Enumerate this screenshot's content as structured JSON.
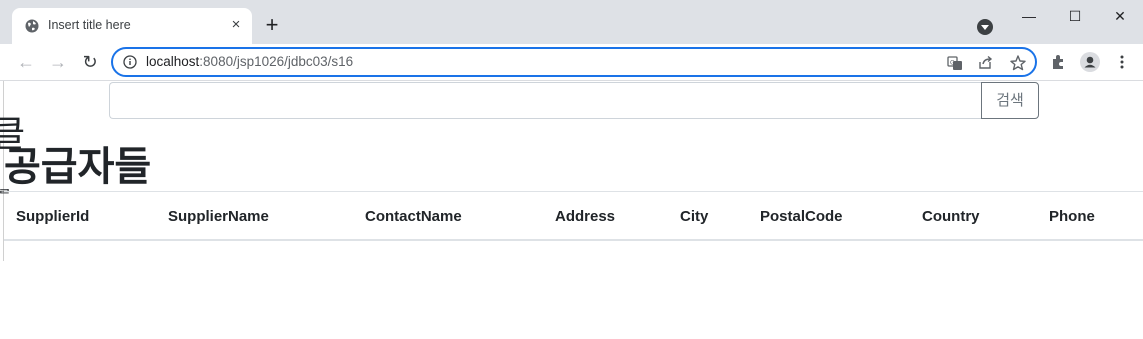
{
  "browser": {
    "tab_title": "Insert title here",
    "tab_close_glyph": "×",
    "new_tab_glyph": "+",
    "url_host": "localhost",
    "url_path": ":8080/jsp1026/jdbc03/s16",
    "window_controls": {
      "minimize": "—",
      "maximize": "☐",
      "close": "✕"
    },
    "nav": {
      "back": "←",
      "forward": "→",
      "reload": "↻"
    }
  },
  "search": {
    "input_value": "",
    "button_label": "검색"
  },
  "page": {
    "heading": "공급자들",
    "edge_glyph_top": "클",
    "edge_glyph_bottom": "ᆯ"
  },
  "table": {
    "columns": [
      "SupplierId",
      "SupplierName",
      "ContactName",
      "Address",
      "City",
      "PostalCode",
      "Country",
      "Phone"
    ],
    "rows": []
  },
  "colors": {
    "accent": "#1a73e8",
    "titlebar": "#dee1e6",
    "button_border": "#6c757d"
  }
}
